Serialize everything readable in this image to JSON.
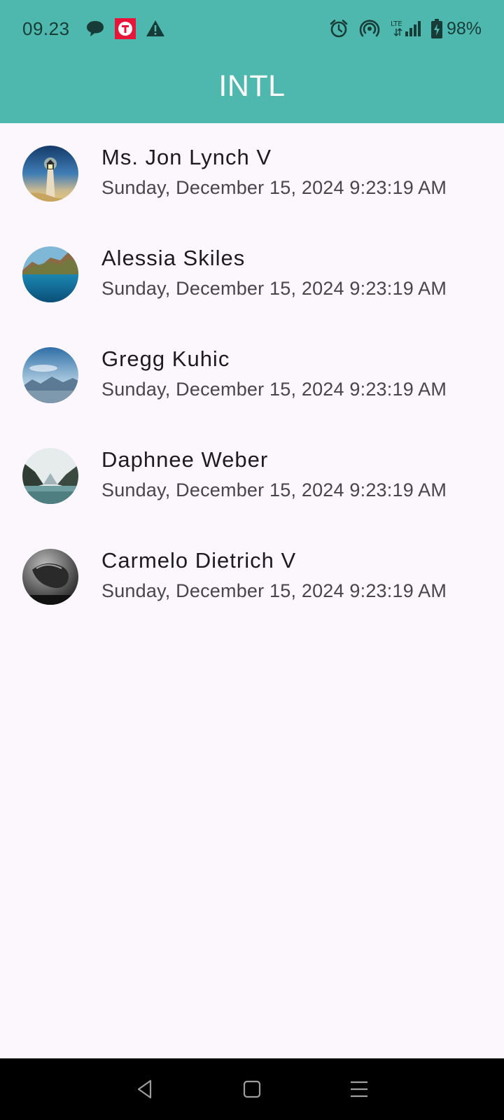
{
  "status_bar": {
    "time": "09.23",
    "left_icons": [
      "chat-bubble-icon",
      "t-app-icon",
      "warning-icon"
    ],
    "right_icons": [
      "alarm-icon",
      "hotspot-icon",
      "lte-signal-icon",
      "battery-charging-icon"
    ],
    "network_label": "LTE",
    "battery": "98%"
  },
  "app_bar": {
    "title": "INTL"
  },
  "colors": {
    "primary": "#4fb8ae",
    "background": "#fcf7fc",
    "text_primary": "#1d1b20",
    "text_secondary": "#49454f"
  },
  "contacts": [
    {
      "name": "Ms. Jon Lynch V",
      "date": "Sunday, December 15, 2024 9:23:19 AM",
      "avatar": "lighthouse-photo"
    },
    {
      "name": "Alessia Skiles",
      "date": "Sunday, December 15, 2024 9:23:19 AM",
      "avatar": "cliff-sea-photo"
    },
    {
      "name": "Gregg Kuhic",
      "date": "Sunday, December 15, 2024 9:23:19 AM",
      "avatar": "sky-mountains-photo"
    },
    {
      "name": "Daphnee Weber",
      "date": "Sunday, December 15, 2024 9:23:19 AM",
      "avatar": "mountain-lake-photo"
    },
    {
      "name": "Carmelo Dietrich V",
      "date": "Sunday, December 15, 2024 9:23:19 AM",
      "avatar": "underwater-manatee-photo"
    }
  ],
  "nav_bar": {
    "buttons": [
      "back-icon",
      "home-icon",
      "recents-icon"
    ]
  }
}
